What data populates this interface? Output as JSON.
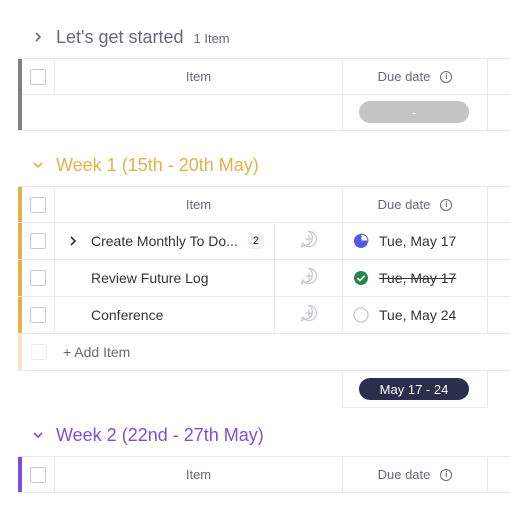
{
  "colors": {
    "group0": "#808080",
    "group1": "#e2b349",
    "group2": "#7d4fd9",
    "progress_icon": "#5559df",
    "done_icon": "#258750"
  },
  "group0": {
    "title": "Let's get started",
    "count": "1 Item",
    "columns": {
      "item": "Item",
      "due": "Due date"
    },
    "summary_pill": "-"
  },
  "group1": {
    "title": "Week 1 (15th - 20th May)",
    "columns": {
      "item": "Item",
      "due": "Due date"
    },
    "rows": [
      {
        "name": "Create Monthly To Do...",
        "subitems": "2",
        "due": "Tue, May 17",
        "status_icon": "pie-progress-icon"
      },
      {
        "name": "Review Future Log",
        "due": "Tue, May 17",
        "status_icon": "check-circle-icon"
      },
      {
        "name": "Conference",
        "due": "Tue, May 24",
        "status_icon": "empty-circle-icon"
      }
    ],
    "add_item": "+ Add Item",
    "summary_pill": "May 17 - 24"
  },
  "group2": {
    "title": "Week 2 (22nd - 27th May)",
    "columns": {
      "item": "Item",
      "due": "Due date"
    }
  },
  "info_glyph": "i"
}
